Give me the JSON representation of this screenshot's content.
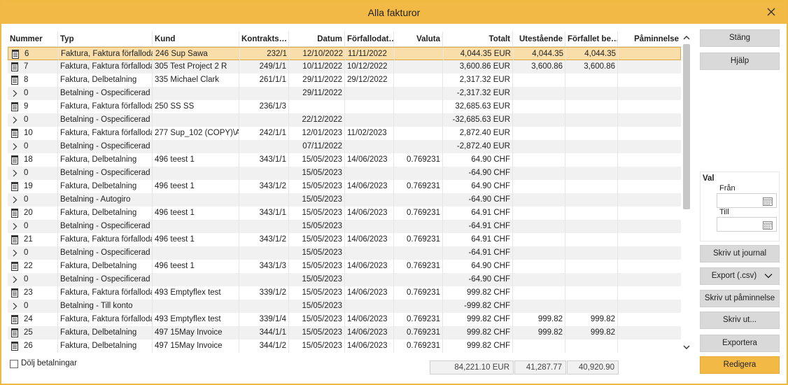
{
  "window": {
    "title": "Alla fakturor"
  },
  "columns": [
    "Nummer",
    "Typ",
    "Kund",
    "Kontrakts…",
    "Datum",
    "Förfallodat…",
    "Valuta",
    "Totalt",
    "Utestående",
    "Förfallet be…",
    "Påminnelse"
  ],
  "rows": [
    {
      "icon": "invoice-icon",
      "nummer": "6",
      "typ": "Faktura, Faktura förfallodag",
      "kund": "246 Sup Sawa",
      "kontrakt": "232/1",
      "datum": "12/10/2022",
      "forfallodatum": "11/11/2022",
      "valuta": "",
      "totalt": "4,044.35 EUR",
      "utestaende": "4,044.35",
      "forfallet": "4,044.35",
      "paminnelse": ""
    },
    {
      "icon": "invoice-icon",
      "nummer": "7",
      "typ": "Faktura, Faktura förfallodag",
      "kund": "305 Test Project 2 R",
      "kontrakt": "249/1/1",
      "datum": "10/11/2022",
      "forfallodatum": "10/12/2022",
      "valuta": "",
      "totalt": "3,600.86 EUR",
      "utestaende": "3,600.86",
      "forfallet": "3,600.86",
      "paminnelse": ""
    },
    {
      "icon": "invoice-icon",
      "nummer": "8",
      "typ": "Faktura, Delbetalning",
      "kund": "335 Michael Clark",
      "kontrakt": "261/1/1",
      "datum": "29/11/2022",
      "forfallodatum": "29/12/2022",
      "valuta": "",
      "totalt": "2,317.32 EUR",
      "utestaende": "",
      "forfallet": "",
      "paminnelse": ""
    },
    {
      "icon": "chevron-right-icon",
      "nummer": "0",
      "typ": "Betalning - Ospecificerad",
      "kund": "",
      "kontrakt": "",
      "datum": "29/11/2022",
      "forfallodatum": "",
      "valuta": "",
      "totalt": "-2,317.32 EUR",
      "utestaende": "",
      "forfallet": "",
      "paminnelse": ""
    },
    {
      "icon": "invoice-icon",
      "nummer": "9",
      "typ": "Faktura, Faktura förfallodag",
      "kund": "250 SS SS",
      "kontrakt": "236/1/3",
      "datum": "",
      "forfallodatum": "",
      "valuta": "",
      "totalt": "32,685.63 EUR",
      "utestaende": "",
      "forfallet": "",
      "paminnelse": ""
    },
    {
      "icon": "chevron-right-icon",
      "nummer": "0",
      "typ": "Betalning - Ospecificerad",
      "kund": "",
      "kontrakt": "",
      "datum": "22/12/2022",
      "forfallodatum": "",
      "valuta": "",
      "totalt": "-32,685.63 EUR",
      "utestaende": "",
      "forfallet": "",
      "paminnelse": ""
    },
    {
      "icon": "invoice-icon",
      "nummer": "10",
      "typ": "Faktura, Faktura förfallodag",
      "kund": "277 Sup_102 (COPY)\\A",
      "kontrakt": "242/1/1",
      "datum": "12/01/2023",
      "forfallodatum": "11/02/2023",
      "valuta": "",
      "totalt": "2,872.40 EUR",
      "utestaende": "",
      "forfallet": "",
      "paminnelse": ""
    },
    {
      "icon": "chevron-right-icon",
      "nummer": "0",
      "typ": "Betalning - Ospecificerad",
      "kund": "",
      "kontrakt": "",
      "datum": "07/11/2022",
      "forfallodatum": "",
      "valuta": "",
      "totalt": "-2,872.40 EUR",
      "utestaende": "",
      "forfallet": "",
      "paminnelse": ""
    },
    {
      "icon": "invoice-icon",
      "nummer": "18",
      "typ": "Faktura, Delbetalning",
      "kund": "496 teest 1",
      "kontrakt": "343/1/1",
      "datum": "15/05/2023",
      "forfallodatum": "14/06/2023",
      "valuta": "0.769231",
      "totalt": "64.90 CHF",
      "utestaende": "",
      "forfallet": "",
      "paminnelse": ""
    },
    {
      "icon": "chevron-right-icon",
      "nummer": "0",
      "typ": "Betalning - Ospecificerad",
      "kund": "",
      "kontrakt": "",
      "datum": "15/05/2023",
      "forfallodatum": "",
      "valuta": "",
      "totalt": "-64.90 CHF",
      "utestaende": "",
      "forfallet": "",
      "paminnelse": ""
    },
    {
      "icon": "invoice-icon",
      "nummer": "19",
      "typ": "Faktura, Delbetalning",
      "kund": "496 teest 1",
      "kontrakt": "343/1/2",
      "datum": "15/05/2023",
      "forfallodatum": "14/06/2023",
      "valuta": "0.769231",
      "totalt": "64.90 CHF",
      "utestaende": "",
      "forfallet": "",
      "paminnelse": ""
    },
    {
      "icon": "chevron-right-icon",
      "nummer": "0",
      "typ": "Betalning - Autogiro",
      "kund": "",
      "kontrakt": "",
      "datum": "15/05/2023",
      "forfallodatum": "",
      "valuta": "",
      "totalt": "-64.90 CHF",
      "utestaende": "",
      "forfallet": "",
      "paminnelse": ""
    },
    {
      "icon": "invoice-icon",
      "nummer": "20",
      "typ": "Faktura, Delbetalning",
      "kund": "496 teest 1",
      "kontrakt": "343/1/1",
      "datum": "15/05/2023",
      "forfallodatum": "14/06/2023",
      "valuta": "0.769231",
      "totalt": "64.91 CHF",
      "utestaende": "",
      "forfallet": "",
      "paminnelse": ""
    },
    {
      "icon": "chevron-right-icon",
      "nummer": "0",
      "typ": "Betalning - Ospecificerad",
      "kund": "",
      "kontrakt": "",
      "datum": "15/05/2023",
      "forfallodatum": "",
      "valuta": "",
      "totalt": "-64.91 CHF",
      "utestaende": "",
      "forfallet": "",
      "paminnelse": ""
    },
    {
      "icon": "invoice-icon",
      "nummer": "21",
      "typ": "Faktura, Faktura förfallodag",
      "kund": "496 teest 1",
      "kontrakt": "343/1/2",
      "datum": "15/05/2023",
      "forfallodatum": "14/06/2023",
      "valuta": "0.769231",
      "totalt": "64.91 CHF",
      "utestaende": "",
      "forfallet": "",
      "paminnelse": ""
    },
    {
      "icon": "chevron-right-icon",
      "nummer": "0",
      "typ": "Betalning - Ospecificerad",
      "kund": "",
      "kontrakt": "",
      "datum": "15/05/2023",
      "forfallodatum": "",
      "valuta": "",
      "totalt": "-64.91 CHF",
      "utestaende": "",
      "forfallet": "",
      "paminnelse": ""
    },
    {
      "icon": "invoice-icon",
      "nummer": "22",
      "typ": "Faktura, Delbetalning",
      "kund": "496 teest 1",
      "kontrakt": "343/1/3",
      "datum": "15/05/2023",
      "forfallodatum": "14/06/2023",
      "valuta": "0.769231",
      "totalt": "64.90 CHF",
      "utestaende": "",
      "forfallet": "",
      "paminnelse": ""
    },
    {
      "icon": "chevron-right-icon",
      "nummer": "0",
      "typ": "Betalning - Ospecificerad",
      "kund": "",
      "kontrakt": "",
      "datum": "15/05/2023",
      "forfallodatum": "",
      "valuta": "",
      "totalt": "-64.90 CHF",
      "utestaende": "",
      "forfallet": "",
      "paminnelse": ""
    },
    {
      "icon": "invoice-icon",
      "nummer": "23",
      "typ": "Faktura, Faktura förfallodag",
      "kund": "493 Emptyflex test",
      "kontrakt": "339/1/2",
      "datum": "15/05/2023",
      "forfallodatum": "14/06/2023",
      "valuta": "0.769231",
      "totalt": "999.82 CHF",
      "utestaende": "",
      "forfallet": "",
      "paminnelse": ""
    },
    {
      "icon": "chevron-right-icon",
      "nummer": "0",
      "typ": "Betalning - Till konto",
      "kund": "",
      "kontrakt": "",
      "datum": "15/05/2023",
      "forfallodatum": "",
      "valuta": "",
      "totalt": "-999.82 CHF",
      "utestaende": "",
      "forfallet": "",
      "paminnelse": ""
    },
    {
      "icon": "invoice-icon",
      "nummer": "24",
      "typ": "Faktura, Faktura förfallodag",
      "kund": "493 Emptyflex test",
      "kontrakt": "339/1/4",
      "datum": "15/05/2023",
      "forfallodatum": "14/06/2023",
      "valuta": "0.769231",
      "totalt": "999.82 CHF",
      "utestaende": "999.82",
      "forfallet": "999.82",
      "paminnelse": ""
    },
    {
      "icon": "invoice-icon",
      "nummer": "25",
      "typ": "Faktura, Delbetalning",
      "kund": "497 15May Invoice",
      "kontrakt": "344/1/1",
      "datum": "15/05/2023",
      "forfallodatum": "14/06/2023",
      "valuta": "0.769231",
      "totalt": "999.82 CHF",
      "utestaende": "999.82",
      "forfallet": "999.82",
      "paminnelse": ""
    },
    {
      "icon": "invoice-icon",
      "nummer": "26",
      "typ": "Faktura, Delbetalning",
      "kund": "497 15May Invoice",
      "kontrakt": "344/1/2",
      "datum": "15/05/2023",
      "forfallodatum": "14/06/2023",
      "valuta": "0.769231",
      "totalt": "999.82 CHF",
      "utestaende": "",
      "forfallet": "",
      "paminnelse": ""
    }
  ],
  "selected_row": 0,
  "buttons": {
    "close": "Stäng",
    "help": "Hjälp",
    "print_journal": "Skriv ut journal",
    "export_csv": "Export (.csv)",
    "print_reminder": "Skriv ut påminnelse",
    "print": "Skriv ut...",
    "export": "Exportera",
    "edit": "Redigera"
  },
  "filter": {
    "title": "Val",
    "from_label": "Från",
    "to_label": "Till",
    "from_value": "",
    "to_value": ""
  },
  "hide_payments": {
    "label": "Dölj betalningar",
    "checked": false
  },
  "totals": {
    "total": "84,221.10 EUR",
    "outstanding": "41,287.77",
    "overdue": "40,920.90"
  },
  "colors": {
    "accent": "#f3b945",
    "selected_row": "#f9deaa",
    "alt_row": "#f1f1f1",
    "button": "#d9d9d9"
  }
}
